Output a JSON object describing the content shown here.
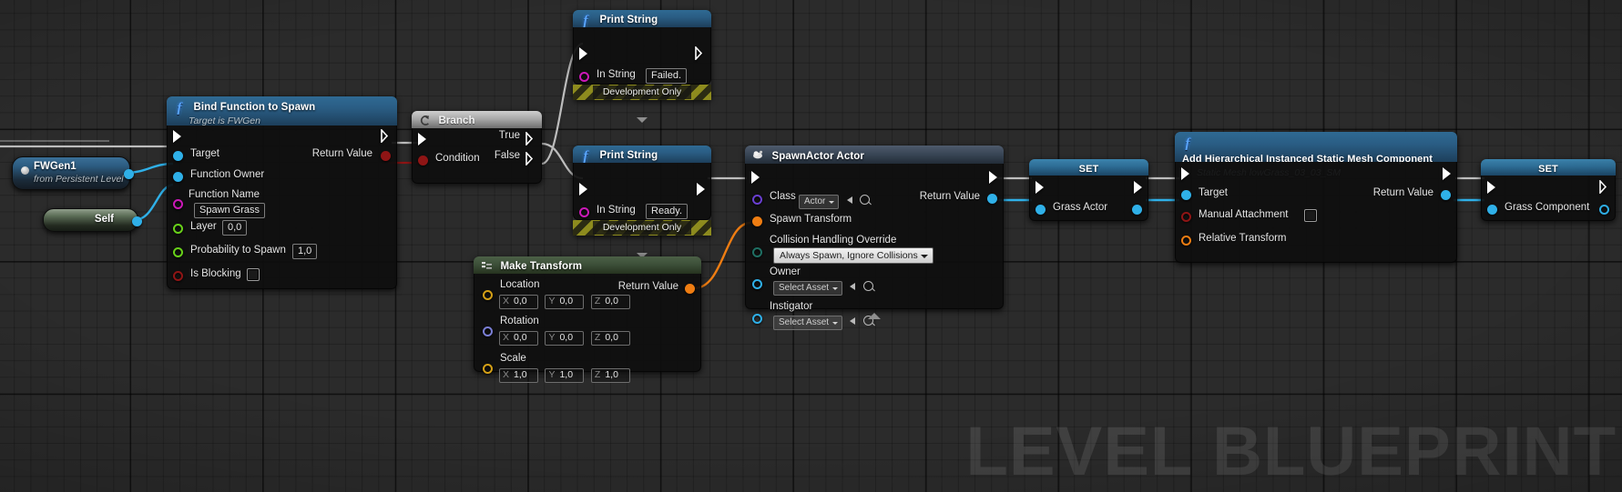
{
  "canvas": {
    "watermark": "LEVEL BLUEPRINT",
    "background_color": "#2b2b2b",
    "grid_color": "#000000"
  },
  "nodes": {
    "fwgen_variable": {
      "title": "FWGen1",
      "subtitle": "from Persistent Level",
      "out_pin_name": "object-out"
    },
    "self_node": {
      "label": "Self"
    },
    "bind_function": {
      "title": "Bind Function to Spawn",
      "subtitle": "Target is FWGen",
      "inputs": [
        {
          "label": "Target",
          "kind": "object"
        },
        {
          "label": "Function Owner",
          "kind": "object"
        },
        {
          "label": "Function Name",
          "kind": "name",
          "value": "Spawn Grass"
        },
        {
          "label": "Layer",
          "kind": "float",
          "value": "0,0"
        },
        {
          "label": "Probability to Spawn",
          "kind": "float",
          "value": "1,0"
        },
        {
          "label": "Is Blocking",
          "kind": "bool",
          "value": false
        }
      ],
      "outputs": [
        {
          "label": "Return Value",
          "kind": "bool"
        }
      ]
    },
    "branch": {
      "title": "Branch",
      "inputs": [
        {
          "label": "Condition",
          "kind": "bool"
        }
      ],
      "outputs": [
        {
          "label": "True"
        },
        {
          "label": "False"
        }
      ]
    },
    "print_failed": {
      "title": "Print String",
      "in_string_label": "In String",
      "in_string_value": "Failed.",
      "dev_band": "Development Only"
    },
    "print_ready": {
      "title": "Print String",
      "in_string_label": "In String",
      "in_string_value": "Ready.",
      "dev_band": "Development Only"
    },
    "make_transform": {
      "title": "Make Transform",
      "rows": [
        {
          "label": "Location",
          "x": "0,0",
          "y": "0,0",
          "z": "0,0"
        },
        {
          "label": "Rotation",
          "x": "0,0",
          "y": "0,0",
          "z": "0,0"
        },
        {
          "label": "Scale",
          "x": "1,0",
          "y": "1,0",
          "z": "1,0"
        }
      ],
      "output_label": "Return Value"
    },
    "spawn_actor": {
      "title": "SpawnActor Actor",
      "class_label": "Class",
      "class_value": "Actor",
      "spawn_transform_label": "Spawn Transform",
      "collision_label": "Collision Handling Override",
      "collision_value": "Always Spawn, Ignore Collisions",
      "owner_label": "Owner",
      "owner_value": "Select Asset",
      "instigator_label": "Instigator",
      "instigator_value": "Select Asset",
      "output_label": "Return Value"
    },
    "set_grass_actor": {
      "title": "SET",
      "variable_label": "Grass Actor"
    },
    "add_hism": {
      "title": "Add Hierarchical Instanced Static Mesh Component",
      "subtitle": "Static Mesh lowGrass_03_03_SM",
      "inputs": [
        {
          "label": "Target",
          "kind": "object"
        },
        {
          "label": "Manual Attachment",
          "kind": "bool",
          "value": false
        },
        {
          "label": "Relative Transform",
          "kind": "struct"
        }
      ],
      "outputs": [
        {
          "label": "Return Value",
          "kind": "object"
        }
      ]
    },
    "set_grass_component": {
      "title": "SET",
      "variable_label": "Grass Component"
    }
  },
  "colors": {
    "exec_white": "#ffffff",
    "object_blue": "#2fb0e8",
    "bool_red": "#8f1515",
    "float_green": "#69d11a",
    "name_magenta": "#cc19b8",
    "class_purple": "#6a3fd1",
    "struct_orange": "#ef7d12",
    "enum_teal": "#1f6f63",
    "rotator_periwinkle": "#7b7fd6",
    "wire_blue": "#2fb0e8",
    "wire_white": "#bdbdbd",
    "wire_red": "#8f1515",
    "wire_orange": "#ef7d12"
  }
}
